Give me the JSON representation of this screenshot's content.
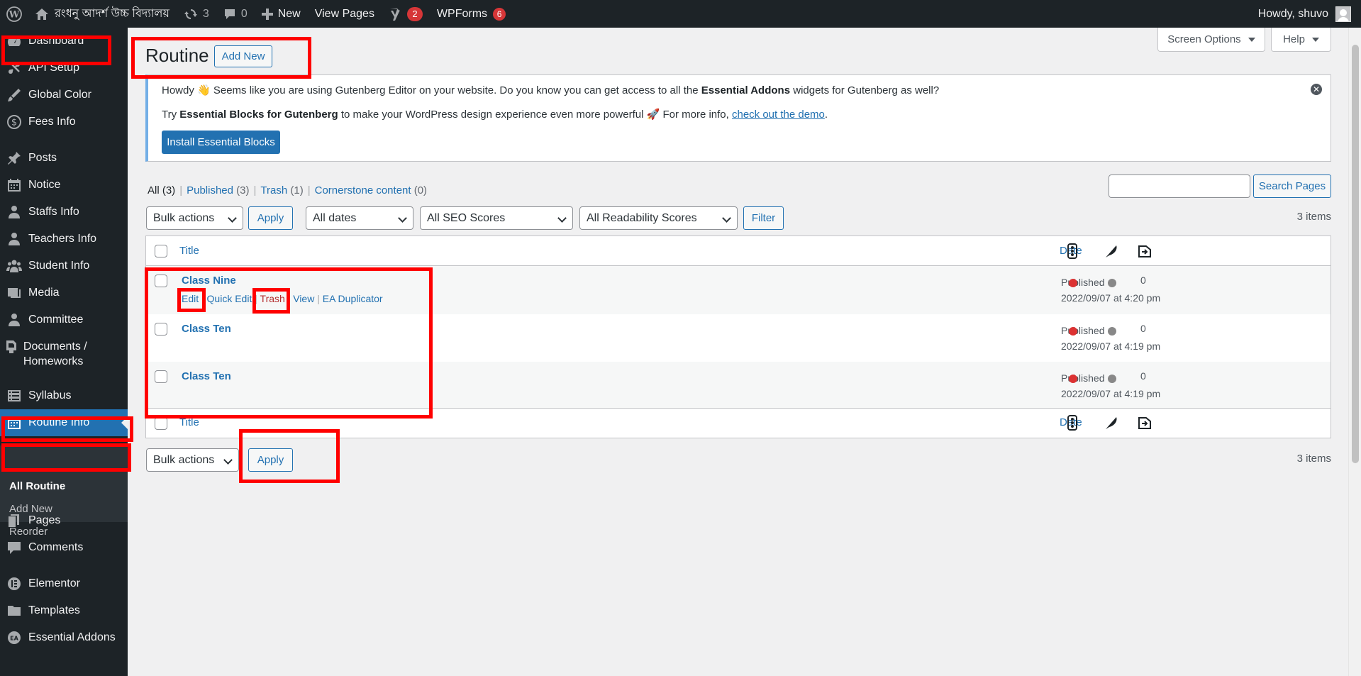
{
  "admin_bar": {
    "site_name": "রংধনু আদর্শ উচ্চ বিদ্যালয়",
    "updates_count": "3",
    "comments_count": "0",
    "new_label": "New",
    "view_pages_label": "View Pages",
    "yoast_badge": "2",
    "wpforms_label": "WPForms",
    "wpforms_badge": "6",
    "howdy": "Howdy, shuvo"
  },
  "sidebar": {
    "items": [
      {
        "label": "Dashboard",
        "icon": "dashboard-icon"
      },
      {
        "label": "API Setup",
        "icon": "api-icon"
      },
      {
        "label": "Global Color",
        "icon": "color-brush-icon"
      },
      {
        "label": "Fees Info",
        "icon": "dollar-icon"
      },
      {
        "label": "Posts",
        "icon": "pin-icon"
      },
      {
        "label": "Notice",
        "icon": "calendar-icon"
      },
      {
        "label": "Staffs Info",
        "icon": "person-icon"
      },
      {
        "label": "Teachers Info",
        "icon": "person-icon"
      },
      {
        "label": "Student Info",
        "icon": "group-icon"
      },
      {
        "label": "Media",
        "icon": "media-icon"
      },
      {
        "label": "Committee",
        "icon": "person-icon"
      },
      {
        "label": "Documents / Homeworks",
        "icon": "document-icon"
      },
      {
        "label": "Syllabus",
        "icon": "list-icon"
      },
      {
        "label": "Routine Info",
        "icon": "calendar-icon"
      },
      {
        "label": "Pages",
        "icon": "page-icon"
      },
      {
        "label": "Comments",
        "icon": "comment-icon"
      },
      {
        "label": "Elementor",
        "icon": "elementor-icon"
      },
      {
        "label": "Templates",
        "icon": "folder-icon"
      },
      {
        "label": "Essential Addons",
        "icon": "ea-icon"
      }
    ],
    "submenu": [
      "All Routine",
      "Add New",
      "Reorder"
    ]
  },
  "header": {
    "screen_options": "Screen Options",
    "help": "Help",
    "title": "Routine",
    "add_new": "Add New"
  },
  "notice": {
    "line1_a": "Howdy 👋 Seems like you are using Gutenberg Editor on your website. Do you know you can get access to all the ",
    "line1_bold": "Essential Addons",
    "line1_b": " widgets for Gutenberg as well?",
    "line2_a": "Try ",
    "line2_bold": "Essential Blocks for Gutenberg",
    "line2_b": " to make your WordPress design experience even more powerful 🚀 For more info, ",
    "line2_link": "check out the demo",
    "line2_c": ".",
    "button": "Install Essential Blocks"
  },
  "views": {
    "all": "All",
    "all_count": "(3)",
    "published": "Published",
    "published_count": "(3)",
    "trash": "Trash",
    "trash_count": "(1)",
    "cornerstone": "Cornerstone content",
    "cornerstone_count": "(0)"
  },
  "search_button": "Search Pages",
  "filters": {
    "bulk_actions": "Bulk actions",
    "apply": "Apply",
    "dates": "All dates",
    "seo": "All SEO Scores",
    "readability": "All Readability Scores",
    "filter": "Filter",
    "items_count": "3 items"
  },
  "table": {
    "col_title": "Title",
    "col_date": "Date",
    "rows": [
      {
        "title": "Class Nine",
        "status": "Published",
        "date": "2022/09/07 at 4:20 pm",
        "count": "0"
      },
      {
        "title": "Class Ten",
        "status": "Published",
        "date": "2022/09/07 at 4:19 pm",
        "count": "0"
      },
      {
        "title": "Class Ten",
        "status": "Published",
        "date": "2022/09/07 at 4:19 pm",
        "count": "0"
      }
    ],
    "row_actions": {
      "edit": "Edit",
      "quick_edit": "Quick Edit",
      "trash": "Trash",
      "view": "View",
      "duplicator": "EA Duplicator",
      "separator": "|"
    }
  },
  "colors": {
    "accent": "#2271b1",
    "admin_dark": "#1d2327",
    "highlight": "#ff0000",
    "score_red": "#dc3232",
    "score_grey": "#888888"
  }
}
